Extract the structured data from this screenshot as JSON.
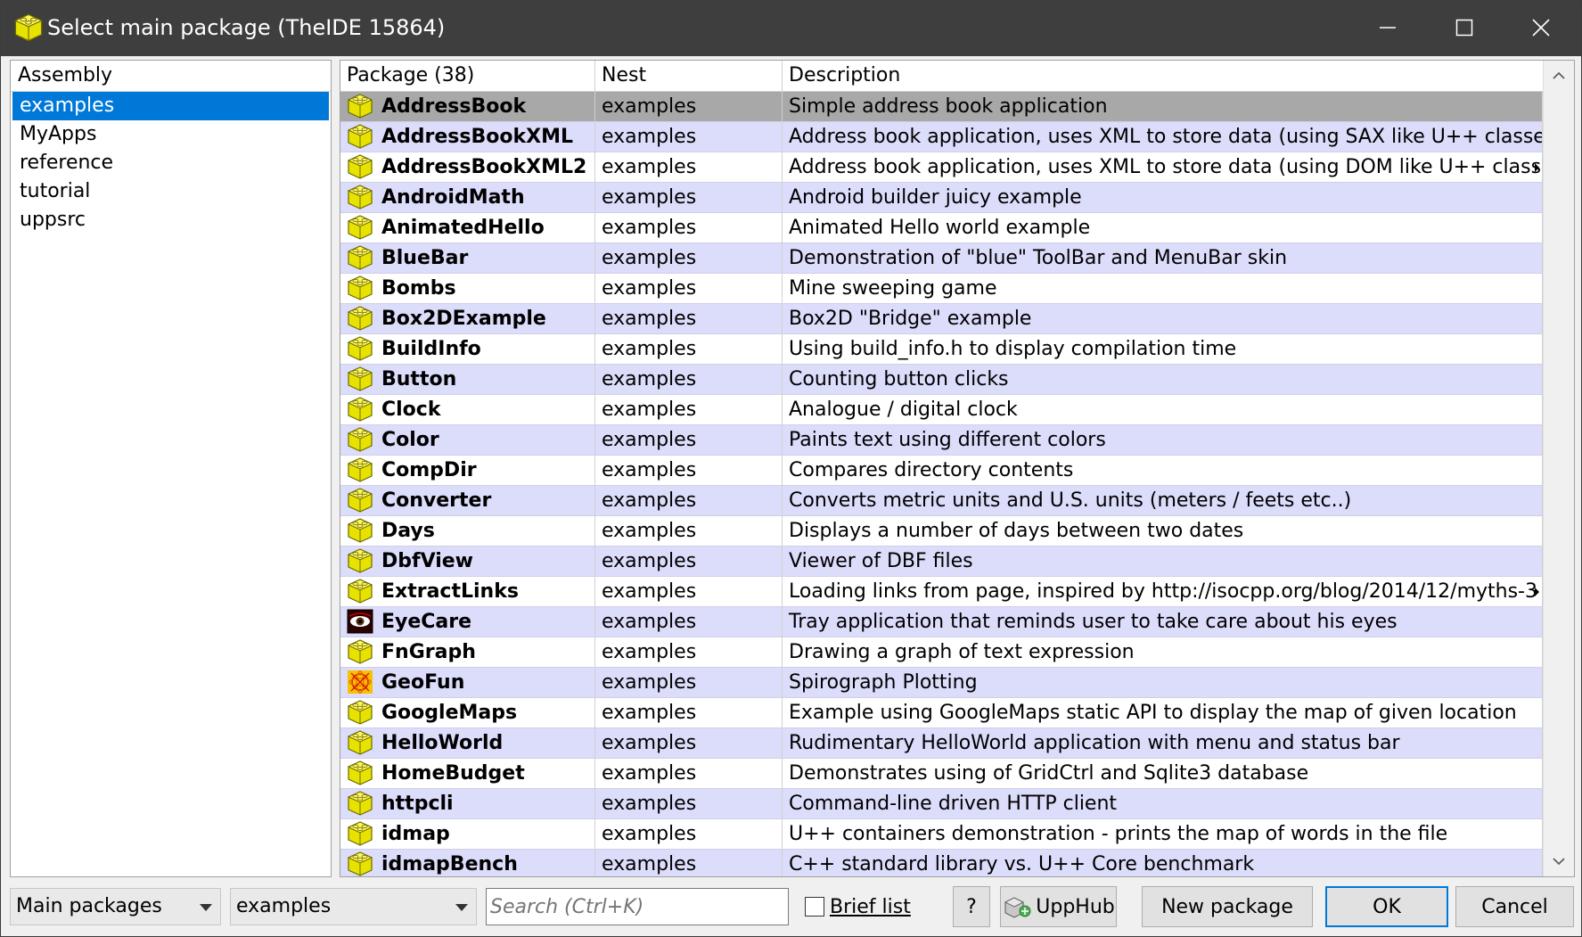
{
  "window": {
    "title": "Select main package (TheIDE 15864)"
  },
  "assembly": {
    "header": "Assembly",
    "items": [
      "examples",
      "MyApps",
      "reference",
      "tutorial",
      "uppsrc"
    ],
    "selected": "examples"
  },
  "packages": {
    "headers": {
      "package": "Package (38)",
      "nest": "Nest",
      "description": "Description"
    },
    "rows": [
      {
        "name": "AddressBook",
        "nest": "examples",
        "description": "Simple address book application",
        "icon": "package-icon"
      },
      {
        "name": "AddressBookXML",
        "nest": "examples",
        "description": "Address book application, uses XML to store data (using SAX like U++ classes)",
        "icon": "package-icon"
      },
      {
        "name": "AddressBookXML2",
        "nest": "examples",
        "description": "Address book application, uses XML to store data (using DOM like U++ classe",
        "icon": "package-icon",
        "truncated": true
      },
      {
        "name": "AndroidMath",
        "nest": "examples",
        "description": "Android builder juicy example",
        "icon": "package-icon"
      },
      {
        "name": "AnimatedHello",
        "nest": "examples",
        "description": "Animated Hello world example",
        "icon": "package-icon"
      },
      {
        "name": "BlueBar",
        "nest": "examples",
        "description": "Demonstration of \"blue\" ToolBar and MenuBar skin",
        "icon": "package-icon"
      },
      {
        "name": "Bombs",
        "nest": "examples",
        "description": "Mine sweeping game",
        "icon": "package-icon"
      },
      {
        "name": "Box2DExample",
        "nest": "examples",
        "description": "Box2D \"Bridge\" example",
        "icon": "package-icon"
      },
      {
        "name": "BuildInfo",
        "nest": "examples",
        "description": "Using build_info.h to display compilation time",
        "icon": "package-icon"
      },
      {
        "name": "Button",
        "nest": "examples",
        "description": "Counting button clicks",
        "icon": "package-icon"
      },
      {
        "name": "Clock",
        "nest": "examples",
        "description": "Analogue / digital clock",
        "icon": "package-icon"
      },
      {
        "name": "Color",
        "nest": "examples",
        "description": "Paints text using different colors",
        "icon": "package-icon"
      },
      {
        "name": "CompDir",
        "nest": "examples",
        "description": "Compares directory contents",
        "icon": "package-icon"
      },
      {
        "name": "Converter",
        "nest": "examples",
        "description": "Converts metric units and U.S. units (meters / feets etc..)",
        "icon": "package-icon"
      },
      {
        "name": "Days",
        "nest": "examples",
        "description": "Displays a number of days between two dates",
        "icon": "package-icon"
      },
      {
        "name": "DbfView",
        "nest": "examples",
        "description": "Viewer of DBF files",
        "icon": "package-icon"
      },
      {
        "name": "ExtractLinks",
        "nest": "examples",
        "description": "Loading links from page, inspired by http://isocpp.org/blog/2014/12/myths-3",
        "icon": "package-icon",
        "truncated": true
      },
      {
        "name": "EyeCare",
        "nest": "examples",
        "description": "Tray application that reminds user to take care about his eyes",
        "icon": "eye-icon"
      },
      {
        "name": "FnGraph",
        "nest": "examples",
        "description": "Drawing a graph of text expression",
        "icon": "package-icon"
      },
      {
        "name": "GeoFun",
        "nest": "examples",
        "description": "Spirograph Plotting",
        "icon": "spirograph-icon"
      },
      {
        "name": "GoogleMaps",
        "nest": "examples",
        "description": "Example using GoogleMaps static API to display the map of given location",
        "icon": "package-icon"
      },
      {
        "name": "HelloWorld",
        "nest": "examples",
        "description": "Rudimentary HelloWorld application with menu and status bar",
        "icon": "package-icon"
      },
      {
        "name": "HomeBudget",
        "nest": "examples",
        "description": "Demonstrates using of GridCtrl and Sqlite3 database",
        "icon": "package-icon"
      },
      {
        "name": "httpcli",
        "nest": "examples",
        "description": "Command-line driven HTTP client",
        "icon": "package-icon"
      },
      {
        "name": "idmap",
        "nest": "examples",
        "description": "U++ containers demonstration - prints the map of words in the file",
        "icon": "package-icon"
      },
      {
        "name": "idmapBench",
        "nest": "examples",
        "description": "C++ standard library vs. U++ Core benchmark",
        "icon": "package-icon"
      }
    ]
  },
  "bottom": {
    "filter_combo": "Main packages",
    "nest_combo": "examples",
    "search_placeholder": "Search (Ctrl+K)",
    "brief_list": "Brief list",
    "help": "?",
    "upphub": "UppHub",
    "new_package": "New package",
    "ok": "OK",
    "cancel": "Cancel"
  },
  "colors": {
    "title_bar": "#3e3e3e",
    "selection": "#0078d7",
    "alt_row": "#dcdcfb",
    "selected_row": "#a8a8a8",
    "package_icon": "#e8e200"
  }
}
